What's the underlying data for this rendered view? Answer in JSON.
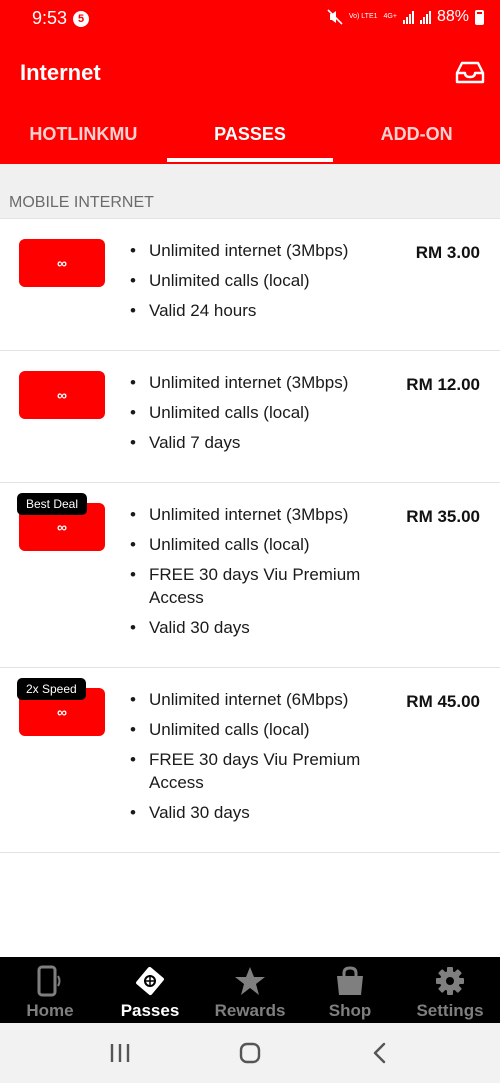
{
  "status": {
    "time": "9:53",
    "notification_count": "5",
    "network": "Vo) LTE1",
    "network2": "4G+",
    "battery": "88%"
  },
  "appbar": {
    "title": "Internet",
    "inbox_icon": "inbox-icon"
  },
  "tabs": [
    {
      "label": "HOTLINKMU",
      "active": false
    },
    {
      "label": "PASSES",
      "active": true
    },
    {
      "label": "ADD-ON",
      "active": false
    }
  ],
  "section": {
    "title": "MOBILE INTERNET"
  },
  "passes": [
    {
      "icon": "∞",
      "badge": "",
      "features": [
        "Unlimited internet (3Mbps)",
        "Unlimited calls (local)",
        "Valid 24 hours"
      ],
      "price": "RM 3.00"
    },
    {
      "icon": "∞",
      "badge": "",
      "features": [
        "Unlimited internet (3Mbps)",
        "Unlimited calls (local)",
        "Valid 7 days"
      ],
      "price": "RM 12.00"
    },
    {
      "icon": "∞",
      "badge": "Best Deal",
      "features": [
        "Unlimited internet (3Mbps)",
        "Unlimited calls (local)",
        "FREE 30 days Viu Premium Access",
        "Valid 30 days"
      ],
      "price": "RM 35.00"
    },
    {
      "icon": "∞",
      "badge": "2x Speed",
      "features": [
        "Unlimited internet (6Mbps)",
        "Unlimited calls (local)",
        "FREE 30 days Viu Premium Access",
        "Valid 30 days"
      ],
      "price": "RM 45.00"
    }
  ],
  "bottom_nav": [
    {
      "label": "Home",
      "icon": "phone-icon",
      "active": false
    },
    {
      "label": "Passes",
      "icon": "pass-ticket-icon",
      "active": true
    },
    {
      "label": "Rewards",
      "icon": "star-icon",
      "active": false
    },
    {
      "label": "Shop",
      "icon": "shopping-bag-icon",
      "active": false
    },
    {
      "label": "Settings",
      "icon": "gear-icon",
      "active": false
    }
  ],
  "colors": {
    "brand": "#ff0000",
    "nav_background": "#000000",
    "nav_inactive": "#7f7f7f"
  }
}
